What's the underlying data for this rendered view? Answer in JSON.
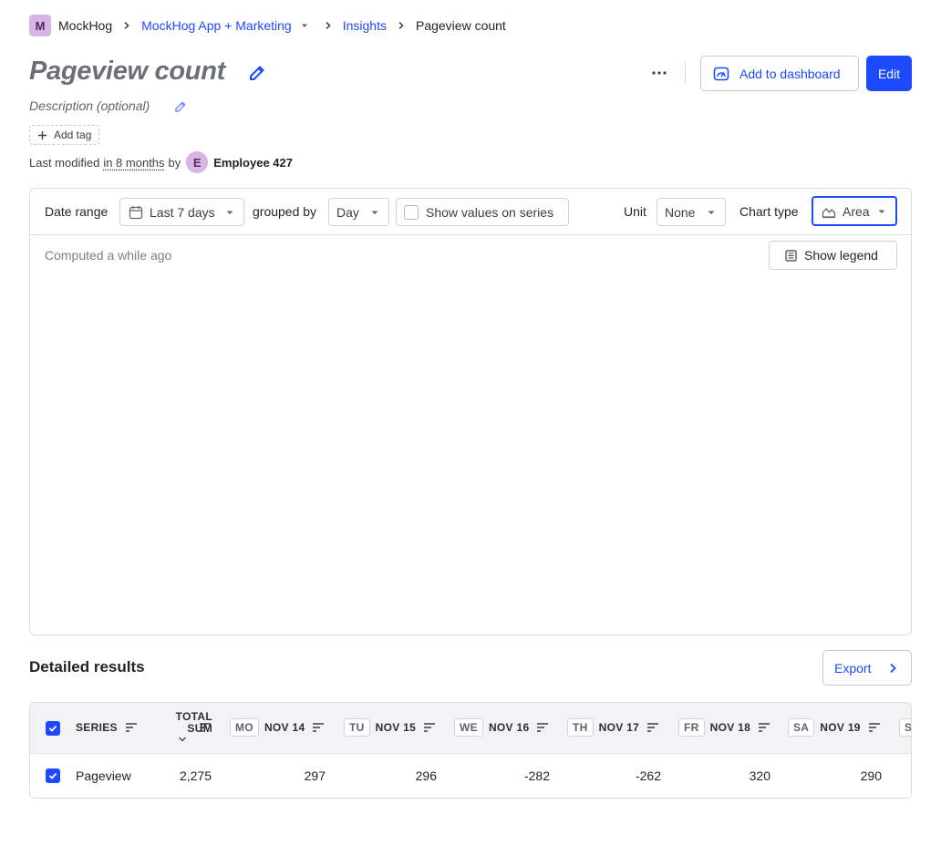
{
  "breadcrumb": {
    "org_initial": "M",
    "org": "MockHog",
    "project": "MockHog App + Marketing",
    "section": "Insights",
    "current": "Pageview count"
  },
  "insight": {
    "title": "Pageview count",
    "description_placeholder": "Description (optional)",
    "add_tag": "Add tag",
    "last_modified_prefix": "Last modified",
    "last_modified_when": "in 8 months",
    "by": "by",
    "user_initial": "E",
    "user_name": "Employee 427"
  },
  "actions": {
    "add_to_dashboard": "Add to dashboard",
    "edit": "Edit"
  },
  "toolbar": {
    "date_range_label": "Date range",
    "date_range_value": "Last 7 days",
    "grouped_by_label": "grouped by",
    "grouped_by_value": "Day",
    "show_values_label": "Show values on series",
    "unit_label": "Unit",
    "unit_value": "None",
    "chart_type_label": "Chart type",
    "chart_type_value": "Area"
  },
  "chart": {
    "computed": "Computed a while ago",
    "show_legend": "Show legend"
  },
  "results": {
    "title": "Detailed results",
    "export": "Export",
    "columns": {
      "series": "SERIES",
      "total_line1": "TOTAL",
      "total_line2": "SUM",
      "days": [
        {
          "badge": "MO",
          "date": "NOV 14"
        },
        {
          "badge": "TU",
          "date": "NOV 15"
        },
        {
          "badge": "WE",
          "date": "NOV 16"
        },
        {
          "badge": "TH",
          "date": "NOV 17"
        },
        {
          "badge": "FR",
          "date": "NOV 18"
        },
        {
          "badge": "SA",
          "date": "NOV 19"
        },
        {
          "badge": "S",
          "date": ""
        }
      ]
    },
    "rows": [
      {
        "series": "Pageview",
        "total": "2,275",
        "values": [
          "297",
          "296",
          "-282",
          "-262",
          "320",
          "290"
        ]
      }
    ]
  },
  "colors": {
    "primary": "#1d4aff",
    "avatar": "#d7b5e6",
    "border": "#d9dbde"
  }
}
